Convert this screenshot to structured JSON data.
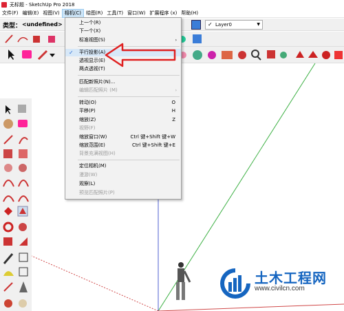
{
  "window": {
    "title": "无标题 - SketchUp Pro 2018"
  },
  "menubar": {
    "items": [
      {
        "label": "文件(F)"
      },
      {
        "label": "编辑(E)"
      },
      {
        "label": "视图(V)"
      },
      {
        "label": "相机(C)"
      },
      {
        "label": "绘图(R)"
      },
      {
        "label": "工具(T)"
      },
      {
        "label": "窗口(W)"
      },
      {
        "label": "扩展程序 (x)"
      },
      {
        "label": "帮助(H)"
      }
    ]
  },
  "typebar": {
    "type_label": "类型：",
    "type_value": "<undefined>",
    "layer": {
      "check": "✓",
      "value": "Layer0"
    }
  },
  "camera_menu": {
    "items": [
      {
        "label": "上一个(R)",
        "shortcut": "",
        "disabled": false
      },
      {
        "label": "下一个(X)",
        "shortcut": "",
        "disabled": false
      },
      {
        "label": "标准视图(S)",
        "shortcut": "",
        "submenu": "›",
        "disabled": false
      },
      {
        "label": "平行投影(A)",
        "shortcut": "",
        "checked": "✓",
        "disabled": false
      },
      {
        "label": "透视显示(E)",
        "shortcut": "",
        "disabled": false
      },
      {
        "label": "两点透视(T)",
        "shortcut": "",
        "disabled": false
      },
      {
        "label": "匹配新照片(N)...",
        "shortcut": "",
        "disabled": false
      },
      {
        "label": "编辑匹配照片 (M)",
        "shortcut": "",
        "submenu": "›",
        "disabled": true
      },
      {
        "label": "转动(O)",
        "shortcut": "O",
        "disabled": false
      },
      {
        "label": "平移(P)",
        "shortcut": "H",
        "disabled": false
      },
      {
        "label": "缩放(Z)",
        "shortcut": "Z",
        "disabled": false
      },
      {
        "label": "视野(F)",
        "shortcut": "",
        "disabled": true
      },
      {
        "label": "缩放窗口(W)",
        "shortcut": "Ctrl 键+Shift 键+W",
        "disabled": false
      },
      {
        "label": "缩放范围(E)",
        "shortcut": "Ctrl 键+Shift 键+E",
        "disabled": false
      },
      {
        "label": "背景充满视图(H)",
        "shortcut": "",
        "disabled": true
      },
      {
        "label": "定位相机(M)",
        "shortcut": "",
        "disabled": false
      },
      {
        "label": "漫游(W)",
        "shortcut": "",
        "disabled": true
      },
      {
        "label": "观察(L)",
        "shortcut": "",
        "disabled": false
      },
      {
        "label": "预览匹配照片(P)",
        "shortcut": "",
        "disabled": true
      }
    ]
  },
  "watermark": {
    "title": "土木工程网",
    "url": "www.civilcn.com"
  },
  "colors": {
    "accent": "#1565c0",
    "arrow": "#e02020",
    "menu_hover": "#cce4f7",
    "axis_green": "#3cb043",
    "axis_blue": "#4f5fd0",
    "axis_red": "#d04848"
  }
}
